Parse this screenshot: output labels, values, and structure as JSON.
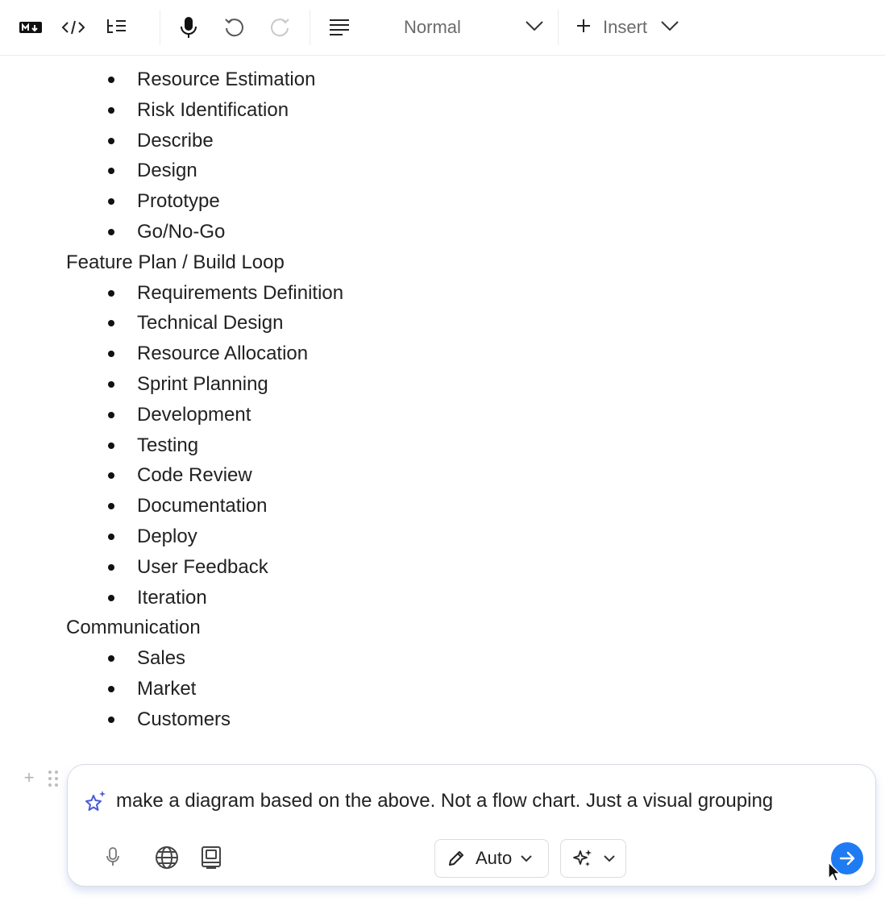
{
  "toolbar": {
    "style_label": "Normal",
    "insert_label": "Insert"
  },
  "document": {
    "sections": [
      {
        "heading": "",
        "items": [
          "Resource Estimation",
          "Risk Identification",
          "Describe",
          "Design",
          "Prototype",
          "Go/No-Go"
        ]
      },
      {
        "heading": "Feature Plan / Build Loop",
        "items": [
          "Requirements Definition",
          "Technical Design",
          "Resource Allocation",
          "Sprint Planning",
          "Development",
          "Testing",
          "Code Review",
          "Documentation",
          "Deploy",
          "User Feedback",
          "Iteration"
        ]
      },
      {
        "heading": "Communication",
        "items": [
          "Sales",
          "Market",
          "Customers"
        ]
      }
    ]
  },
  "prompt": {
    "text": "make a diagram based on the above. Not a flow chart. Just a visual grouping",
    "mode_label": "Auto"
  },
  "colors": {
    "accent": "#1e7bf2",
    "sparkle": "#4a5bd6"
  }
}
